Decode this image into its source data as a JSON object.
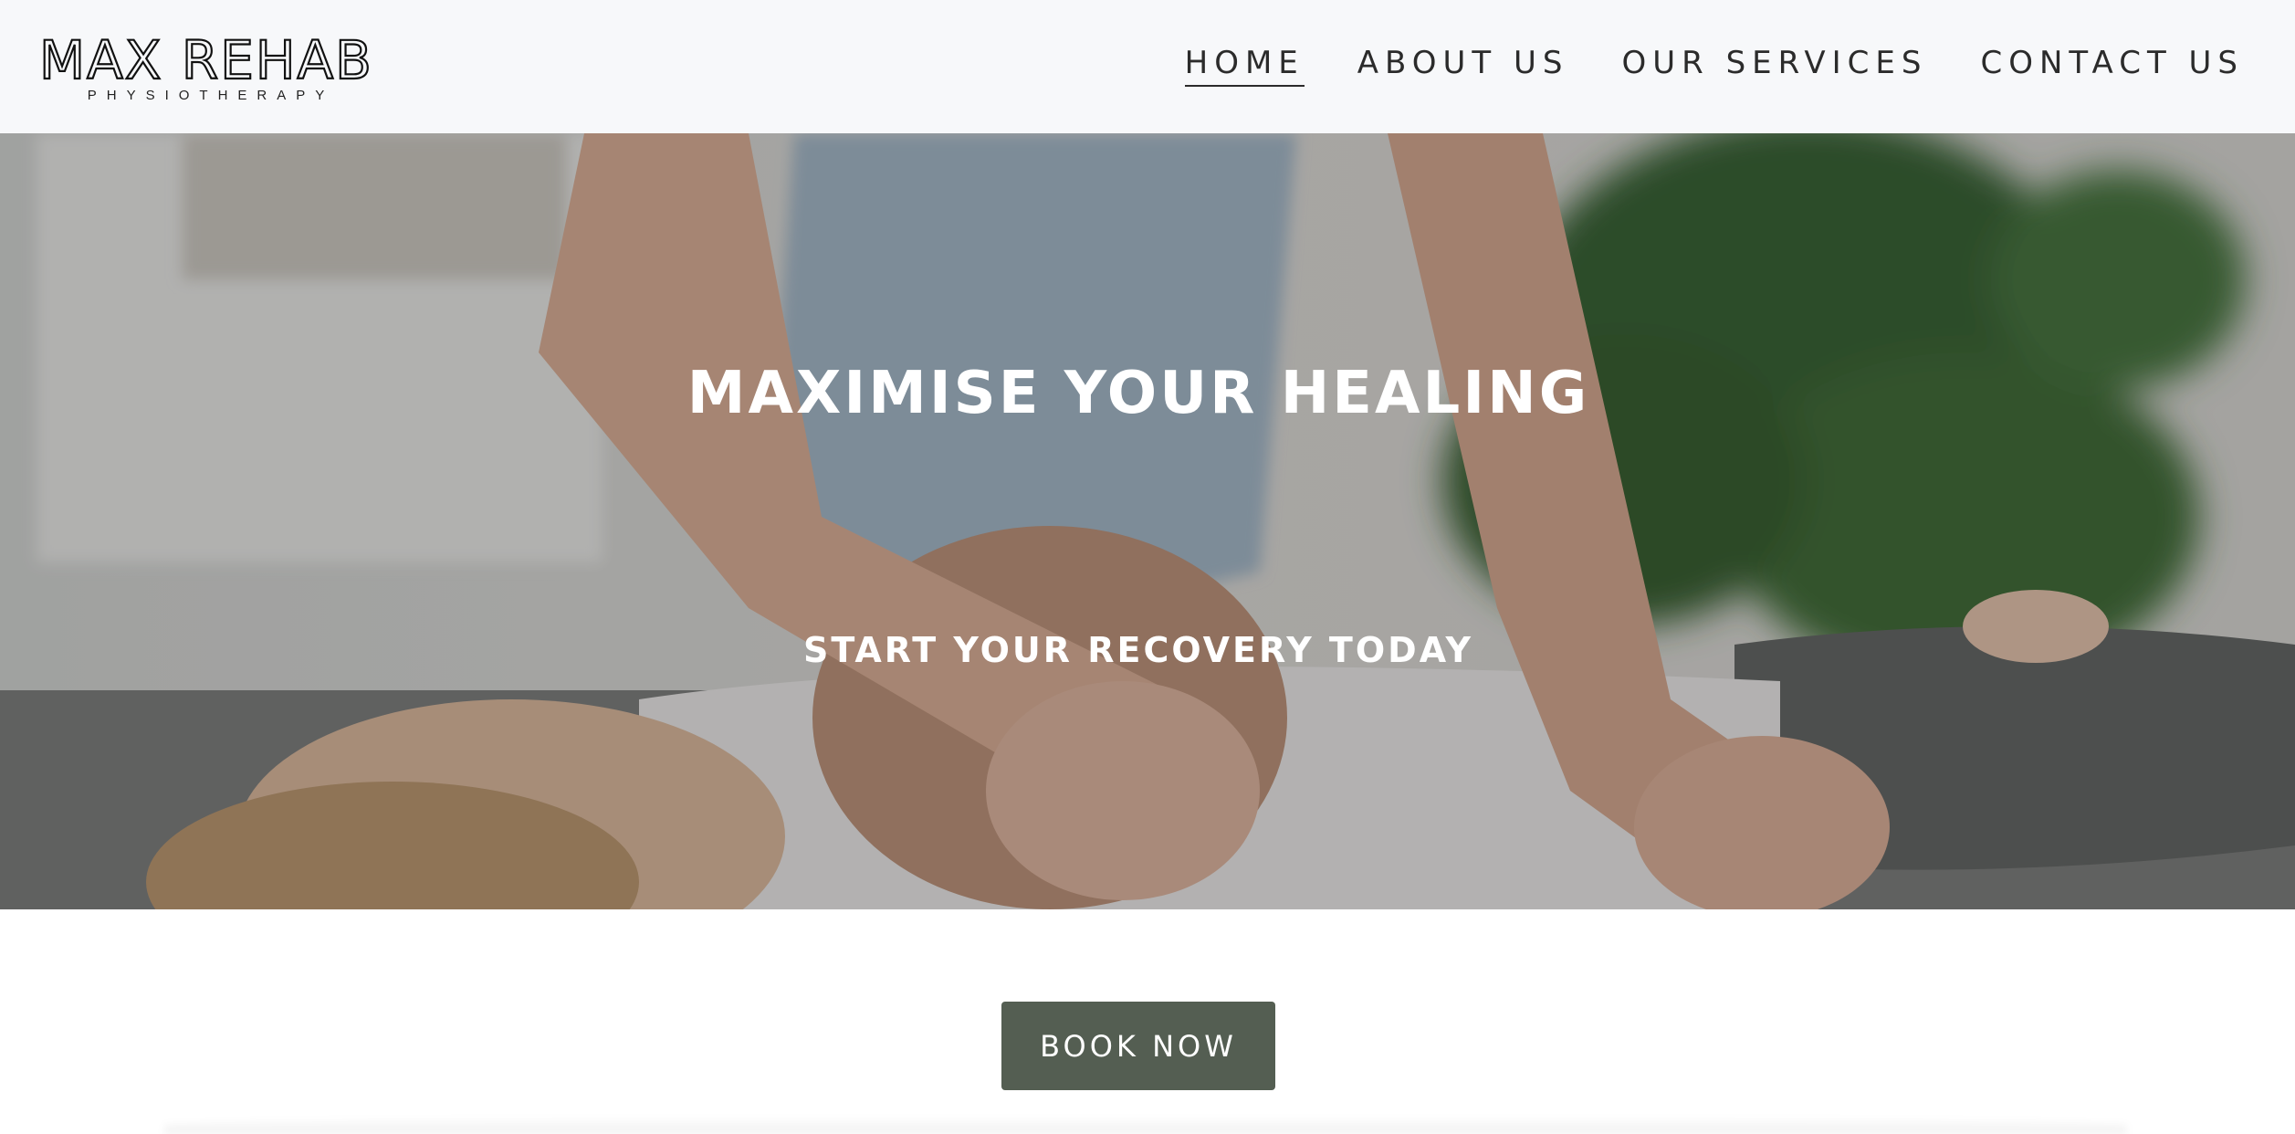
{
  "header": {
    "logo_title": "MAX REHAB",
    "logo_subtitle": "PHYSIOTHERAPY",
    "nav": [
      {
        "label": "HOME",
        "active": true
      },
      {
        "label": "ABOUT US",
        "active": false
      },
      {
        "label": "OUR SERVICES",
        "active": false
      },
      {
        "label": "CONTACT US",
        "active": false
      }
    ]
  },
  "hero": {
    "title": "MAXIMISE YOUR HEALING",
    "subtitle": "START YOUR RECOVERY TODAY",
    "image_description": "physiotherapist-treating-patient-photo"
  },
  "cta": {
    "label": "BOOK NOW"
  },
  "colors": {
    "header_bg": "#f7f8fa",
    "button_bg": "#545e52",
    "text_dark": "#2b2b2b",
    "hero_text": "#ffffff"
  }
}
